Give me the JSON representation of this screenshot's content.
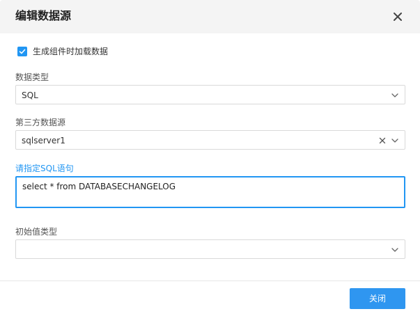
{
  "dialog": {
    "title": "编辑数据源",
    "close_icon": "close-icon"
  },
  "options": {
    "load_on_generate_label": "生成组件时加载数据",
    "load_on_generate_checked": true
  },
  "fields": {
    "data_type": {
      "label": "数据类型",
      "value": "SQL"
    },
    "third_party_source": {
      "label": "第三方数据源",
      "value": "sqlserver1"
    },
    "sql": {
      "label": "请指定SQL语句",
      "value": "select * from DATABASECHANGELOG"
    },
    "initial_value_type": {
      "label": "初始值类型",
      "value": ""
    }
  },
  "footer": {
    "close_button_label": "关闭"
  },
  "colors": {
    "accent": "#2196f3",
    "button": "#2f96f0",
    "header_bg": "#f4f4f4",
    "border": "#d9d9d9"
  }
}
